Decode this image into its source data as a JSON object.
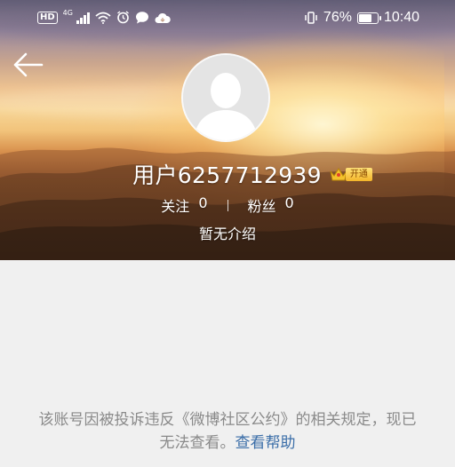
{
  "status_bar": {
    "left_badges": [
      "HD",
      "4G"
    ],
    "battery_percent": "76%",
    "battery_level": 0.76,
    "time": "10:40",
    "icons": [
      "hd-icon",
      "signal-icon",
      "wifi-icon",
      "alarm-icon",
      "message-icon",
      "cloud-icon",
      "vibrate-icon",
      "battery-icon"
    ]
  },
  "header": {
    "back_icon": "back-arrow-icon"
  },
  "profile": {
    "avatar_icon": "default-avatar-icon",
    "username": "用户6257712939",
    "vip_badge": "开通",
    "vip_icon": "crown-icon",
    "following_label": "关注",
    "following_count": "0",
    "followers_label": "粉丝",
    "followers_count": "0",
    "bio": "暂无介绍"
  },
  "notice": {
    "text": "该账号因被投诉违反《微博社区公约》的相关规定，现已无法查看。",
    "link_text": "查看帮助"
  },
  "colors": {
    "link": "#3b6ea8",
    "notice_text": "#8a8a8a",
    "page_bg": "#f0f0f0"
  }
}
